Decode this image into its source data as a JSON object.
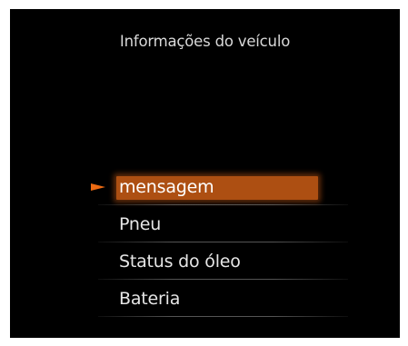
{
  "screen": {
    "title": "Informações do veículo"
  },
  "menu": {
    "selected_index": 0,
    "accent_color": "#ad4f12",
    "pointer_icon": "selection-arrow-icon",
    "items": [
      {
        "label": "mensagem"
      },
      {
        "label": "Pneu"
      },
      {
        "label": "Status do óleo"
      },
      {
        "label": "Bateria"
      }
    ]
  }
}
